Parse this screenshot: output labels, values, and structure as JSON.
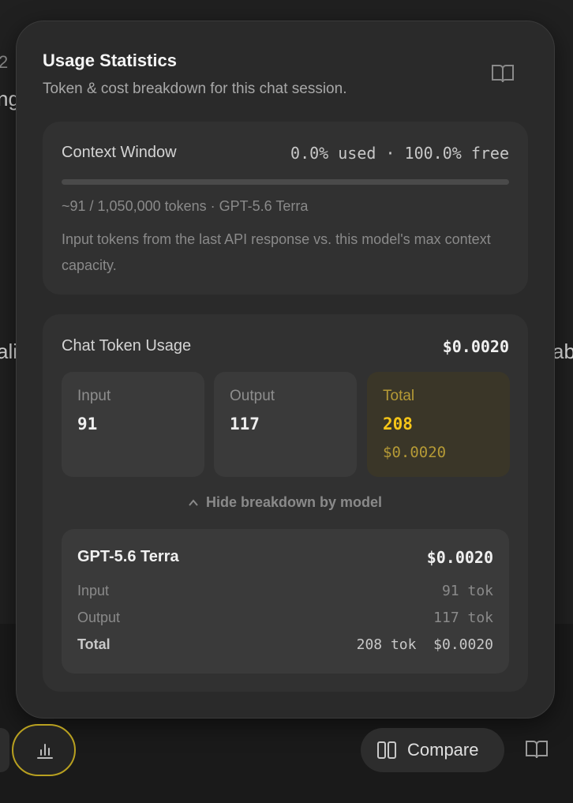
{
  "modal": {
    "title": "Usage Statistics",
    "subtitle": "Token & cost breakdown for this chat session.",
    "book_icon": "book-open-icon"
  },
  "context": {
    "title": "Context Window",
    "usage_text": "0.0% used · 100.0% free",
    "used_fraction": 0.0,
    "tokens_text": "~91 / 1,050,000 tokens · GPT-5.6 Terra",
    "description": "Input tokens from the last API response vs. this model's max context capacity."
  },
  "usage": {
    "title": "Chat Token Usage",
    "total_cost": "$0.0020",
    "input": {
      "label": "Input",
      "value": "91"
    },
    "output": {
      "label": "Output",
      "value": "117"
    },
    "total": {
      "label": "Total",
      "value": "208",
      "cost": "$0.0020"
    },
    "toggle_label": "Hide breakdown by model",
    "model": {
      "name": "GPT-5.6 Terra",
      "cost": "$0.0020",
      "rows": [
        {
          "label": "Input",
          "value": "91 tok"
        },
        {
          "label": "Output",
          "value": "117 tok"
        },
        {
          "label": "Total",
          "value": "208 tok  $0.0020"
        }
      ]
    }
  },
  "background": {
    "frag_1": "2",
    "frag_2": "ng",
    "frag_3": "ali",
    "frag_4": "ab"
  },
  "toolbar": {
    "stats_icon": "bar-chart-icon",
    "compare_label": "Compare",
    "compare_icon": "columns-icon",
    "book_icon": "book-open-icon"
  },
  "colors": {
    "accent": "#f5c518",
    "highlight_border": "#b8a020"
  }
}
